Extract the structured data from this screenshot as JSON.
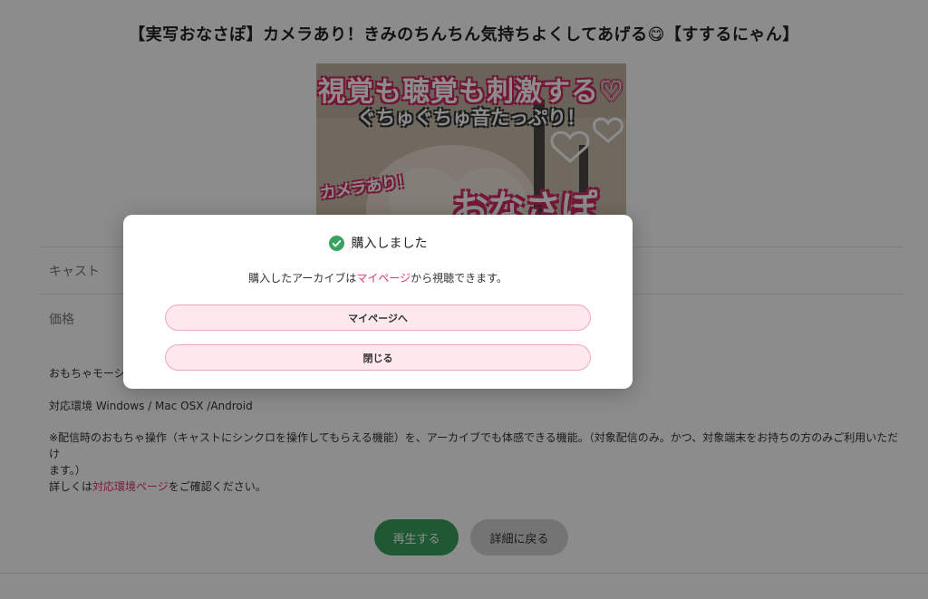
{
  "page": {
    "title": "【実写おなさぽ】カメラあり！きみのちんちん気持ちよくしてあげる😋【すするにゃん】"
  },
  "thumbnail": {
    "caption_line1": "視覚も聴覚も刺激する♡",
    "caption_line2": "ぐちゅぐちゅ音たっぷり！",
    "caption_line3": "カメラあり！",
    "caption_line4": "おなさぽ"
  },
  "details": {
    "cast_label": "キャスト",
    "price_label": "価格",
    "toy_text": "おもちゃモーション",
    "env_text": "対応環境 Windows / Mac OSX /Android",
    "note_text_1": "※配信時のおもちゃ操作（キャストにシンクロを操作してもらえる機能）を、アーカイブでも体感できる機能。（対象配信のみ。かつ、対象端末をお持ちの方のみご利用いただけ",
    "note_text_2": "ます。）",
    "note_prefix": "詳しくは",
    "note_link": "対応環境ページ",
    "note_suffix": "をご確認ください。"
  },
  "actions": {
    "play_label": "再生する",
    "back_label": "詳細に戻る"
  },
  "modal": {
    "icon": "check-circle-icon",
    "heading": "購入しました",
    "message_prefix": "購入したアーカイブは",
    "message_link": "マイページ",
    "message_suffix": "から視聴できます。",
    "mypage_button": "マイページへ",
    "close_button": "閉じる"
  },
  "colors": {
    "accent_pink": "#e0326a",
    "play_green": "#3aa35f",
    "check_green": "#3aa35f",
    "modal_button_bg": "#fde8ee"
  }
}
